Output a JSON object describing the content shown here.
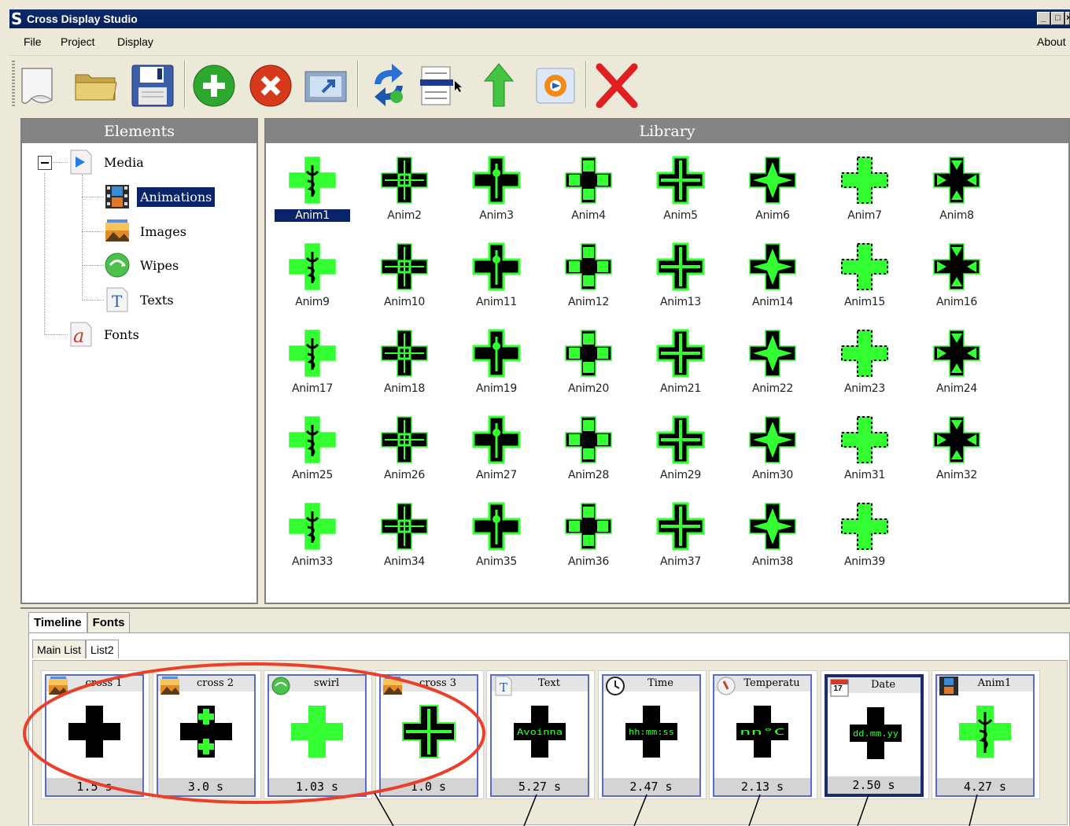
{
  "window": {
    "title": "Cross Display Studio",
    "logo_letter": "S"
  },
  "menu": {
    "items": [
      "File",
      "Project",
      "Display"
    ],
    "about": "About"
  },
  "toolbar": {
    "buttons": [
      "new-file-icon",
      "open-folder-icon",
      "save-icon",
      "add-icon",
      "remove-icon",
      "export-icon",
      "sync-icon",
      "list-select-icon",
      "move-up-icon",
      "preview-icon",
      "delete-icon"
    ]
  },
  "elements_panel": {
    "header": "Elements",
    "tree": {
      "media": "Media",
      "animations": "Animations",
      "images": "Images",
      "wipes": "Wipes",
      "texts": "Texts",
      "fonts": "Fonts"
    }
  },
  "library_panel": {
    "header": "Library",
    "items": [
      "Anim1",
      "Anim2",
      "Anim3",
      "Anim4",
      "Anim5",
      "Anim6",
      "Anim7",
      "Anim8",
      "Anim9",
      "Anim10",
      "Anim11",
      "Anim12",
      "Anim13",
      "Anim14",
      "Anim15",
      "Anim16",
      "Anim17",
      "Anim18",
      "Anim19",
      "Anim20",
      "Anim21",
      "Anim22",
      "Anim23",
      "Anim24",
      "Anim25",
      "Anim26",
      "Anim27",
      "Anim28",
      "Anim29",
      "Anim30",
      "Anim31",
      "Anim32",
      "Anim33",
      "Anim34",
      "Anim35",
      "Anim36",
      "Anim37",
      "Anim38",
      "Anim39"
    ],
    "selected": "Anim1"
  },
  "bottom": {
    "tabs": [
      "Timeline",
      "Fonts"
    ],
    "subtabs": [
      "Main List",
      "List2"
    ],
    "timeline": [
      {
        "name": "cross 1",
        "duration": "1.5 s",
        "icon": "image-icon"
      },
      {
        "name": "cross 2",
        "duration": "3.0 s",
        "icon": "image-icon"
      },
      {
        "name": "swirl",
        "duration": "1.03 s",
        "icon": "wipe-icon"
      },
      {
        "name": "cross 3",
        "duration": "1.0 s",
        "icon": "image-icon"
      },
      {
        "name": "Text",
        "duration": "5.27 s",
        "icon": "text-icon",
        "display": "Avoinna"
      },
      {
        "name": "Time",
        "duration": "2.47 s",
        "icon": "clock-icon",
        "display": "hh:mm:ss"
      },
      {
        "name": "Temperatu",
        "duration": "2.13 s",
        "icon": "thermometer-icon",
        "display": "nn°C"
      },
      {
        "name": "Date",
        "duration": "2.50 s",
        "icon": "calendar-icon",
        "display": "dd.mm.yy",
        "calendar_day": "17"
      },
      {
        "name": "Anim1",
        "duration": "4.27 s",
        "icon": "animation-icon"
      }
    ]
  },
  "colors": {
    "led_green": "#33ff33",
    "selection": "#0a246a",
    "annotation_red": "#e8402a"
  }
}
